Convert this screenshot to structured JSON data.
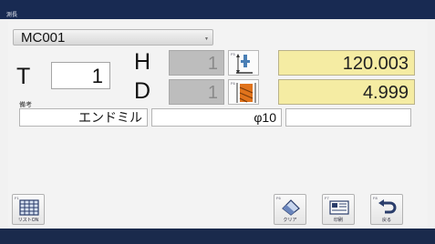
{
  "window": {
    "title": "測長"
  },
  "machine": {
    "selected": "MC001"
  },
  "labels": {
    "t": "T",
    "h": "H",
    "d": "D",
    "remark": "備考"
  },
  "tool": {
    "t_number": "1",
    "h_number": "1",
    "d_number": "1",
    "h_value": "120.003",
    "d_value": "4.999",
    "tool_name": "エンドミル",
    "diameter": "φ10",
    "note": ""
  },
  "fkeys": {
    "h_icon": {
      "key": "F5"
    },
    "d_icon": {
      "key": "F6"
    },
    "list_on": {
      "key": "F1",
      "label": "リストON"
    },
    "clear": {
      "key": "F6",
      "label": "クリア"
    },
    "print": {
      "key": "F7",
      "label": "印刷"
    },
    "back": {
      "key": "F8",
      "label": "戻る"
    }
  },
  "colors": {
    "titlebar": "#182a52",
    "value_box": "#f5eca3",
    "icon_orange": "#e0731c"
  }
}
